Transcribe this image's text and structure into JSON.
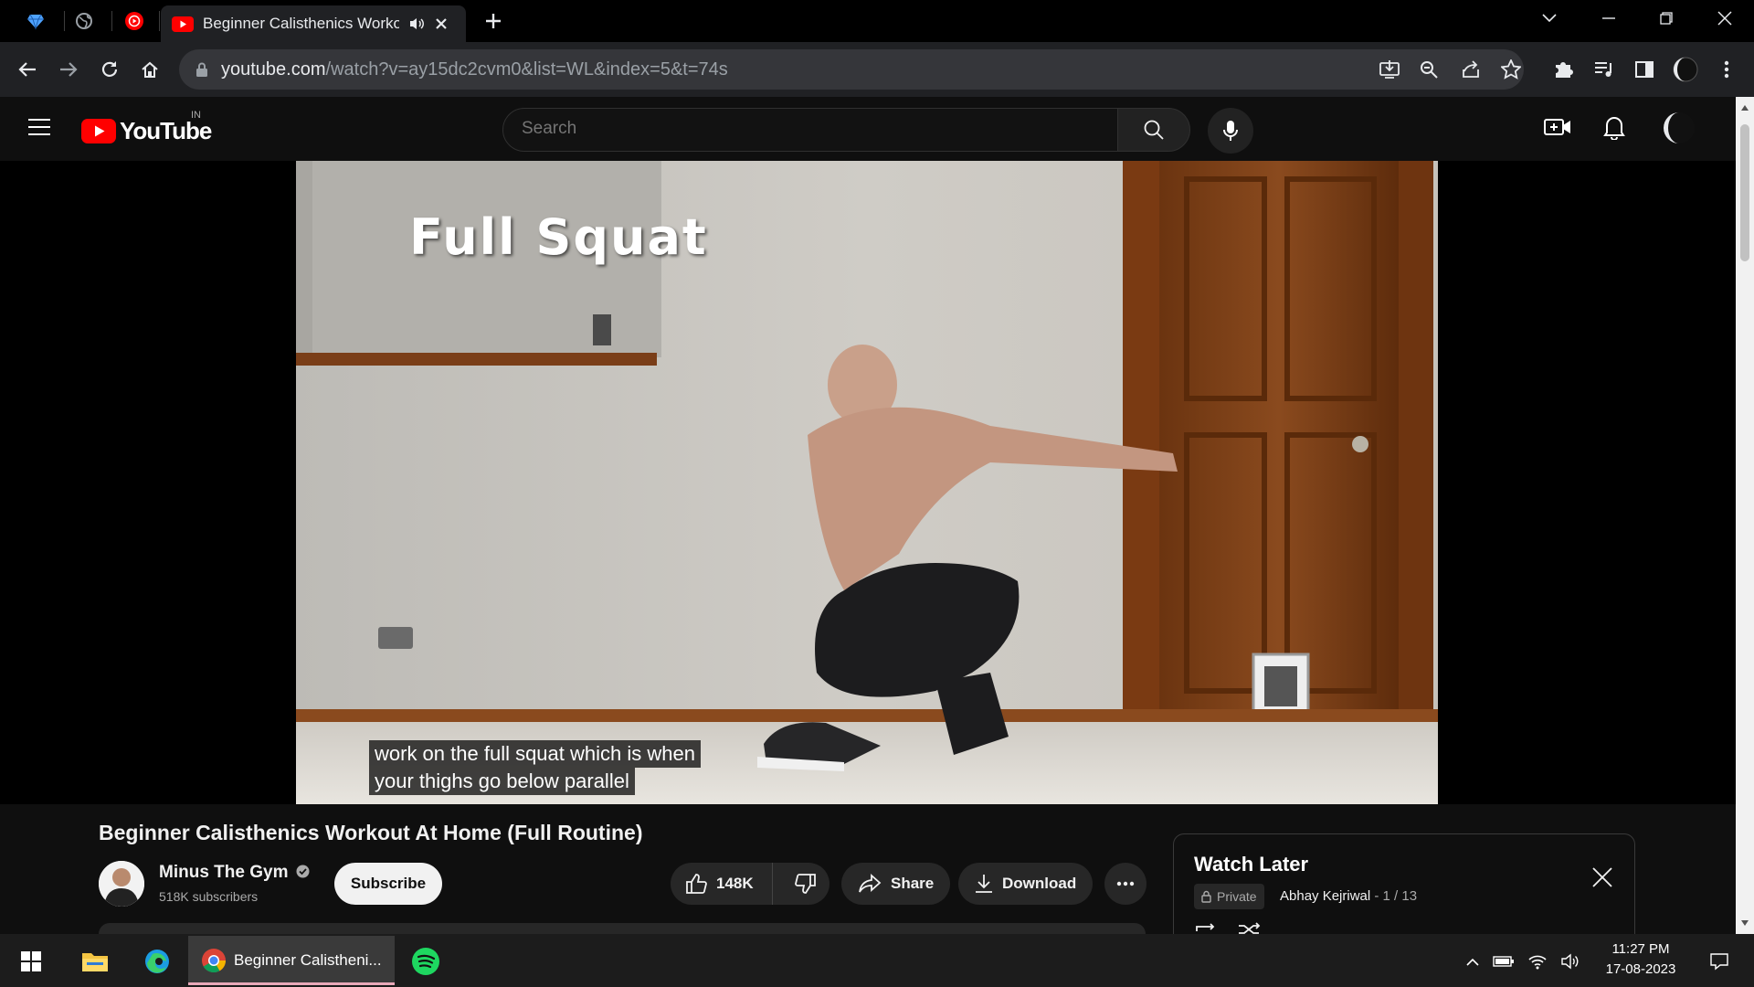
{
  "browser": {
    "tab_title": "Beginner Calisthenics Workout At Home (Full Routine)",
    "url_host": "youtube.com",
    "url_path": "/watch?v=ay15dc2cvm0&list=WL&index=5&t=74s"
  },
  "youtube": {
    "logo_text": "YouTube",
    "country_code": "IN",
    "search_placeholder": "Search"
  },
  "video": {
    "overlay_text": "Full Squat",
    "caption_line1": "work on the full squat which is when",
    "caption_line2": "your thighs go below parallel",
    "title": "Beginner Calisthenics Workout At Home (Full Routine)",
    "channel_name": "Minus The Gym",
    "subscribers": "518K subscribers",
    "subscribe_label": "Subscribe",
    "likes": "148K",
    "share_label": "Share",
    "download_label": "Download"
  },
  "watch_later": {
    "title": "Watch Later",
    "privacy": "Private",
    "owner": "Abhay Kejriwal",
    "position": " - 1 / 13"
  },
  "taskbar": {
    "chrome_label": "Beginner Calistheni...",
    "time": "11:27 PM",
    "date": "17-08-2023"
  },
  "colors": {
    "yt_red": "#ff0000",
    "background": "#0f0f0f"
  }
}
